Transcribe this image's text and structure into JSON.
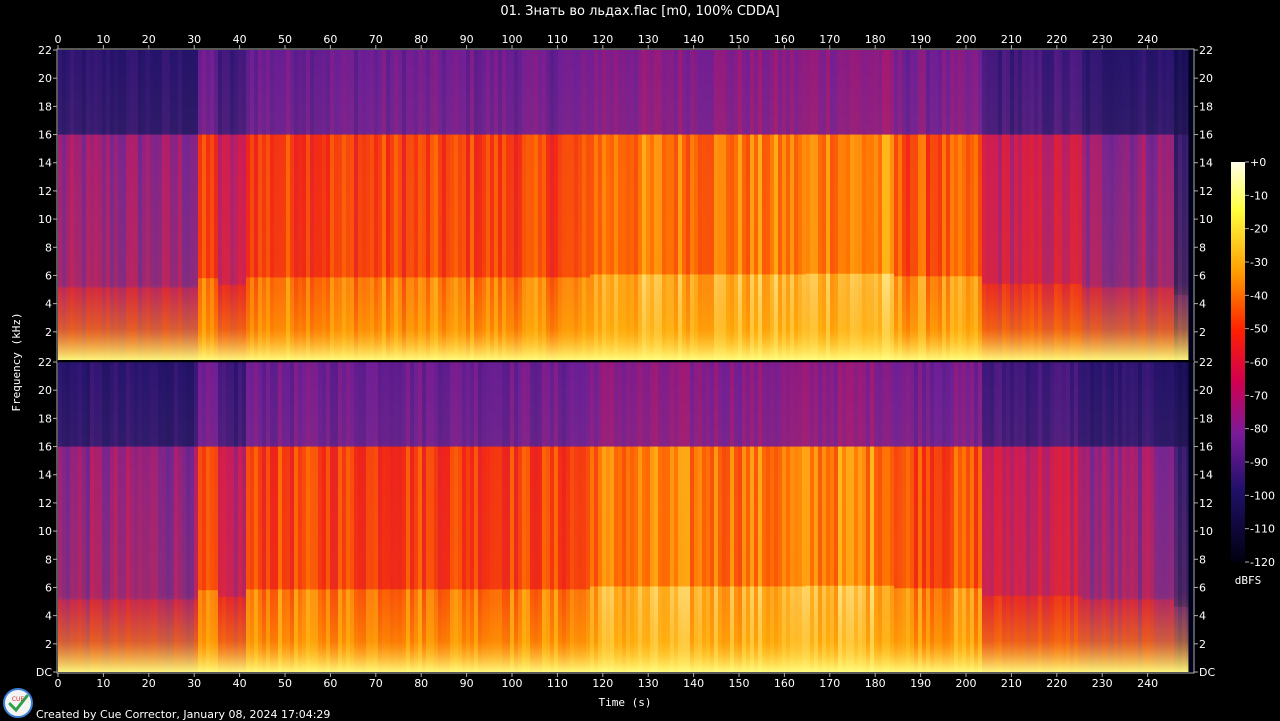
{
  "title": "01. Знать во льдах.flac [m0, 100% CDDA]",
  "footer": "Created by Cue Corrector, January 08, 2024 17:04:29",
  "logo_text": "CUE",
  "chart_data": {
    "type": "heatmap",
    "title": "01. Знать во льдах.flac [m0, 100% CDDA]",
    "xlabel": "Time (s)",
    "ylabel": "Frequency (kHz)",
    "xlim": [
      0,
      250
    ],
    "ylim": [
      0,
      22
    ],
    "x_ticks": [
      "0",
      "10",
      "20",
      "30",
      "40",
      "50",
      "60",
      "70",
      "80",
      "90",
      "100",
      "110",
      "120",
      "130",
      "140",
      "150",
      "160",
      "170",
      "180",
      "190",
      "200",
      "210",
      "220",
      "230",
      "240"
    ],
    "y_ticks_top": [
      "22",
      "20",
      "18",
      "16",
      "14",
      "12",
      "10",
      "8",
      "6",
      "4",
      "2"
    ],
    "y_ticks_bottom": [
      "22",
      "20",
      "18",
      "16",
      "14",
      "12",
      "10",
      "8",
      "6",
      "4",
      "2",
      "DC"
    ],
    "channels": 2,
    "colorbar": {
      "label": "dBFS",
      "ticks": [
        "+0",
        "-10",
        "-20",
        "-30",
        "-40",
        "-50",
        "-60",
        "-70",
        "-80",
        "-90",
        "-100",
        "-110",
        "-120"
      ],
      "range": [
        0,
        -120
      ]
    },
    "lowpass_cutoff_khz": 16,
    "duration_s": 249,
    "segments": [
      {
        "t0": 0,
        "t1": 30,
        "level": 0.45
      },
      {
        "t0": 30,
        "t1": 35,
        "level": 0.7
      },
      {
        "t0": 35,
        "t1": 41,
        "level": 0.52
      },
      {
        "t0": 41,
        "t1": 117,
        "level": 0.72
      },
      {
        "t0": 117,
        "t1": 164,
        "level": 0.8
      },
      {
        "t0": 164,
        "t1": 184,
        "level": 0.82
      },
      {
        "t0": 184,
        "t1": 203,
        "level": 0.75
      },
      {
        "t0": 203,
        "t1": 225,
        "level": 0.55
      },
      {
        "t0": 225,
        "t1": 245,
        "level": 0.45
      },
      {
        "t0": 245,
        "t1": 249,
        "level": 0.25
      }
    ]
  }
}
